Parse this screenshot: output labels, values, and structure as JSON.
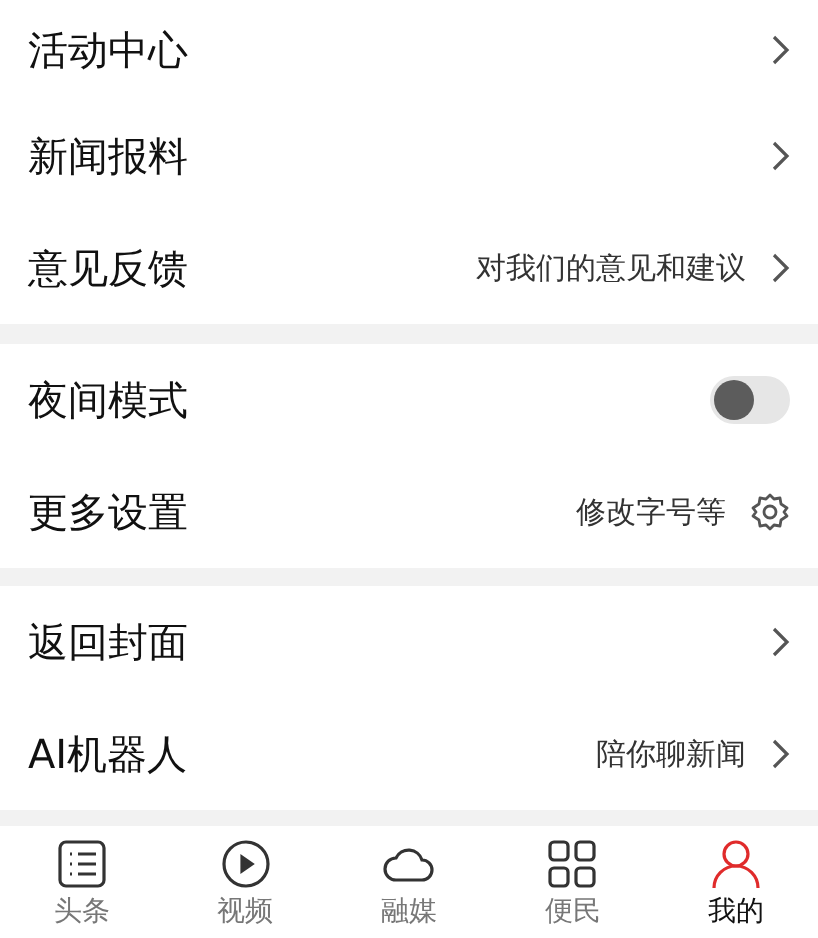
{
  "groups": [
    {
      "rows": [
        {
          "label": "活动中心",
          "kind": "link"
        },
        {
          "label": "新闻报料",
          "kind": "link"
        },
        {
          "label": "意见反馈",
          "kind": "link",
          "hint": "对我们的意见和建议"
        }
      ]
    },
    {
      "rows": [
        {
          "label": "夜间模式",
          "kind": "toggle",
          "on": false
        },
        {
          "label": "更多设置",
          "kind": "settings",
          "hint": "修改字号等"
        }
      ]
    },
    {
      "rows": [
        {
          "label": "返回封面",
          "kind": "link"
        },
        {
          "label": "AI机器人",
          "kind": "link",
          "hint": "陪你聊新闻"
        }
      ]
    }
  ],
  "tabs": [
    {
      "label": "头条",
      "kind": "list",
      "selected": false
    },
    {
      "label": "视频",
      "kind": "play",
      "selected": false
    },
    {
      "label": "融媒",
      "kind": "cloud",
      "selected": false
    },
    {
      "label": "便民",
      "kind": "grid",
      "selected": false
    },
    {
      "label": "我的",
      "kind": "person",
      "selected": true
    }
  ]
}
